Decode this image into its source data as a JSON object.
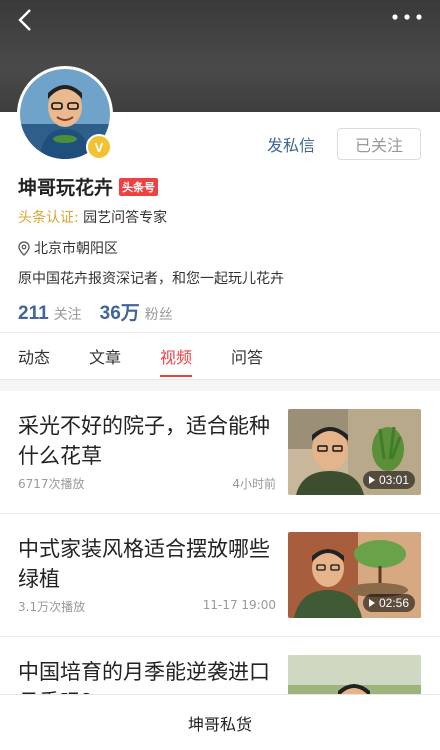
{
  "profile": {
    "name": "坤哥玩花卉",
    "badge": "头条号",
    "verified_badge": "V",
    "cert_label": "头条认证:",
    "cert_value": "园艺问答专家",
    "location": "北京市朝阳区",
    "bio": "原中国花卉报资深记者，和您一起玩儿花卉",
    "following_count": "211",
    "following_label": "关注",
    "fans_count": "36万",
    "fans_label": "粉丝"
  },
  "actions": {
    "message_label": "发私信",
    "follow_label": "已关注"
  },
  "tabs": [
    {
      "label": "动态",
      "active": false
    },
    {
      "label": "文章",
      "active": false
    },
    {
      "label": "视频",
      "active": true
    },
    {
      "label": "问答",
      "active": false
    }
  ],
  "videos": [
    {
      "title": "采光不好的院子，适合能种什么花草",
      "views": "6717次播放",
      "time": "4小时前",
      "duration": "03:01"
    },
    {
      "title": "中式家装风格适合摆放哪些绿植",
      "views": "3.1万次播放",
      "time": "11-17 19:00",
      "duration": "02:56"
    },
    {
      "title": "中国培育的月季能逆袭进口月季吗？",
      "views": "",
      "time": "",
      "duration": ""
    }
  ],
  "bottom_bar": {
    "label": "坤哥私货"
  },
  "colors": {
    "accent_red": "#f04142",
    "link_blue": "#406599",
    "gold": "#d8a632"
  }
}
